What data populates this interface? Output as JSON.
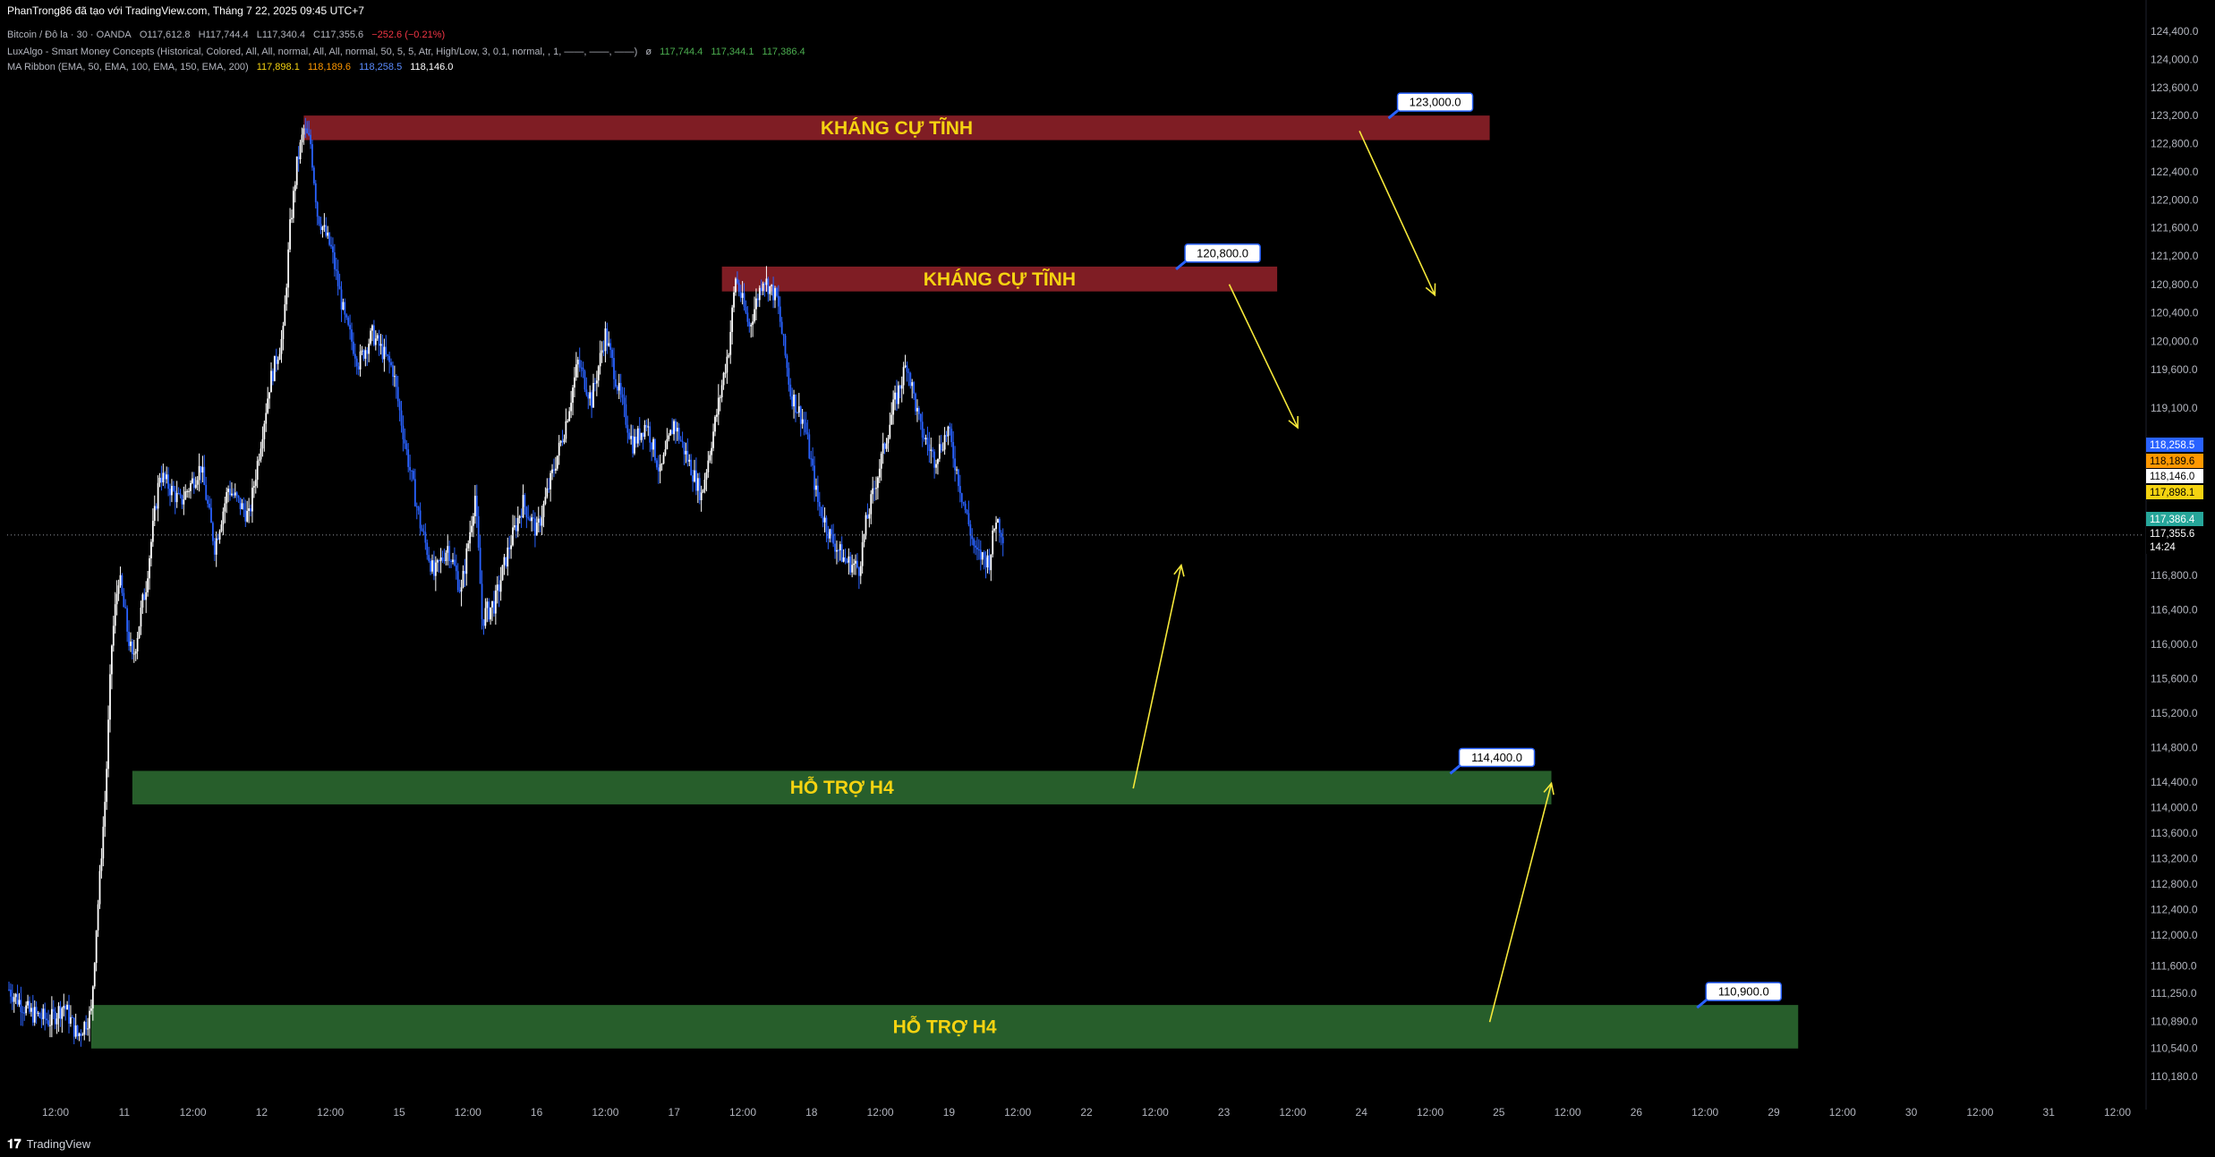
{
  "header": {
    "publisher_line": "PhanTrong86 đã tạo với TradingView.com, Tháng 7 22, 2025 09:45 UTC+7",
    "symbol": "Bitcoin / Đô la · 30 · OANDA",
    "ohlc": {
      "open": "O117,612.8",
      "high": "H117,744.4",
      "low": "L117,340.4",
      "close": "C117,355.6",
      "change": "−252.6 (−0.21%)"
    },
    "indicator1": {
      "name": "LuxAlgo - Smart Money Concepts (Historical, Colored, All, All, normal, All, All, normal, 50, 5, 5, Atr, High/Low, 3, 0.1, normal, , 1, ——, ——, ——)",
      "values": [
        "117,744.4",
        "117,344.1",
        "117,386.4"
      ]
    },
    "indicator2": {
      "name": "MA Ribbon (EMA, 50, EMA, 100, EMA, 150, EMA, 200)",
      "values": [
        "117,898.1",
        "118,189.6",
        "118,258.5",
        "118,146.0"
      ]
    }
  },
  "colors": {
    "background": "#000000",
    "bull_candle": "#ffffff",
    "bear_candle": "#2962ff",
    "resistance_zone": "#7f1d24",
    "support_zone": "#275e2b",
    "zone_text": "#f5d311",
    "arrow": "#f5e83a",
    "ema50": "#f5d311",
    "ema100": "#ff9800",
    "ema150": "#2962ff",
    "ema200": "#ffffff",
    "last_price": "#26a69a"
  },
  "chart_data": {
    "type": "candlestick",
    "ylim": [
      109900,
      124600
    ],
    "price_ticks": [
      "124,400.0",
      "124,000.0",
      "123,600.0",
      "123,200.0",
      "122,800.0",
      "122,400.0",
      "122,000.0",
      "121,600.0",
      "121,200.0",
      "120,800.0",
      "120,400.0",
      "120,000.0",
      "119,600.0",
      "119,100.0",
      "116,800.0",
      "116,400.0",
      "116,000.0",
      "115,600.0",
      "115,200.0",
      "114,800.0",
      "114,400.0",
      "114,000.0",
      "113,600.0",
      "113,200.0",
      "112,800.0",
      "112,400.0",
      "112,000.0",
      "111,600.0",
      "111,250.0",
      "110,890.0",
      "110,540.0",
      "110,180.0"
    ],
    "time_ticks": [
      "12:00",
      "11",
      "12:00",
      "12",
      "12:00",
      "15",
      "12:00",
      "16",
      "12:00",
      "17",
      "12:00",
      "18",
      "12:00",
      "19",
      "12:00",
      "22",
      "12:00",
      "23",
      "12:00",
      "24",
      "12:00",
      "25",
      "12:00",
      "26",
      "12:00",
      "29",
      "12:00",
      "30",
      "12:00",
      "31",
      "12:00"
    ],
    "price_path": [
      [
        0,
        111.3
      ],
      [
        3,
        111.0
      ],
      [
        6,
        110.9
      ],
      [
        8,
        111.1
      ],
      [
        10,
        110.7
      ],
      [
        12,
        111.0
      ],
      [
        13,
        112.5
      ],
      [
        14,
        114.1
      ],
      [
        15,
        116.0
      ],
      [
        16,
        116.8
      ],
      [
        18,
        115.8
      ],
      [
        20,
        116.7
      ],
      [
        22,
        118.2
      ],
      [
        25,
        117.8
      ],
      [
        28,
        118.3
      ],
      [
        30,
        117.2
      ],
      [
        32,
        118.0
      ],
      [
        35,
        117.6
      ],
      [
        38,
        119.4
      ],
      [
        40,
        120.1
      ],
      [
        41,
        121.6
      ],
      [
        42,
        122.5
      ],
      [
        43,
        123.0
      ],
      [
        44,
        122.8
      ],
      [
        45,
        121.8
      ],
      [
        47,
        121.3
      ],
      [
        49,
        120.3
      ],
      [
        51,
        119.7
      ],
      [
        53,
        120.1
      ],
      [
        56,
        119.6
      ],
      [
        58,
        118.5
      ],
      [
        60,
        117.5
      ],
      [
        62,
        116.8
      ],
      [
        64,
        117.2
      ],
      [
        66,
        116.6
      ],
      [
        68,
        117.9
      ],
      [
        69,
        116.3
      ],
      [
        71,
        116.5
      ],
      [
        73,
        117.2
      ],
      [
        75,
        117.8
      ],
      [
        77,
        117.4
      ],
      [
        79,
        118.1
      ],
      [
        81,
        118.8
      ],
      [
        83,
        119.7
      ],
      [
        85,
        119.2
      ],
      [
        87,
        120.1
      ],
      [
        89,
        119.3
      ],
      [
        91,
        118.6
      ],
      [
        93,
        118.9
      ],
      [
        95,
        118.2
      ],
      [
        97,
        118.9
      ],
      [
        99,
        118.4
      ],
      [
        101,
        117.9
      ],
      [
        103,
        118.9
      ],
      [
        105,
        119.9
      ],
      [
        106,
        120.9
      ],
      [
        108,
        120.2
      ],
      [
        110,
        120.9
      ],
      [
        112,
        120.6
      ],
      [
        114,
        119.3
      ],
      [
        116,
        118.9
      ],
      [
        118,
        117.8
      ],
      [
        120,
        117.3
      ],
      [
        122,
        117.0
      ],
      [
        124,
        116.9
      ],
      [
        125,
        117.5
      ],
      [
        127,
        118.3
      ],
      [
        129,
        119.1
      ],
      [
        131,
        119.7
      ],
      [
        133,
        118.8
      ],
      [
        135,
        118.4
      ],
      [
        137,
        118.8
      ],
      [
        139,
        117.9
      ],
      [
        141,
        117.1
      ],
      [
        143,
        117.0
      ],
      [
        144,
        117.6
      ],
      [
        145,
        117.36
      ]
    ],
    "zones": [
      {
        "label": "KHÁNG CỰ TĨNH",
        "kind": "resistance",
        "top": 123200,
        "bottom": 122850,
        "x_start": 43,
        "x_end": 216,
        "tag": "123,000.0"
      },
      {
        "label": "KHÁNG CỰ TĨNH",
        "kind": "resistance",
        "top": 121050,
        "bottom": 120700,
        "x_start": 104,
        "x_end": 185,
        "tag": "120,800.0"
      },
      {
        "label": "HỖ TRỢ H4",
        "kind": "support",
        "top": 114530,
        "bottom": 114050,
        "x_start": 18,
        "x_end": 225,
        "tag": "114,400.0"
      },
      {
        "label": "HỖ TRỢ H4",
        "kind": "support",
        "top": 111100,
        "bottom": 110540,
        "x_start": 12,
        "x_end": 261,
        "tag": "110,900.0"
      }
    ],
    "arrows": [
      {
        "from": [
          197,
          122980
        ],
        "to": [
          208,
          120650
        ]
      },
      {
        "from": [
          178,
          120800
        ],
        "to": [
          188,
          118830
        ]
      },
      {
        "from": [
          164,
          114300
        ],
        "to": [
          171,
          116940
        ]
      },
      {
        "from": [
          216,
          110880
        ],
        "to": [
          225,
          114380
        ]
      }
    ],
    "price_labels": [
      {
        "text": "118,258.5",
        "price": 118258.5,
        "color_key": "ema150"
      },
      {
        "text": "118,189.6",
        "price": 118189.6,
        "color_key": "ema100"
      },
      {
        "text": "118,146.0",
        "price": 118146.0,
        "color_key": "ema200"
      },
      {
        "text": "117,898.1",
        "price": 117898.1,
        "color_key": "ema50"
      },
      {
        "text": "117,386.4",
        "price": 117386.4,
        "color_key": "last_price"
      },
      {
        "text": "117,355.6",
        "price": 117355.6,
        "color_key": "background"
      },
      {
        "text": "14:24",
        "price": 117355.6,
        "color_key": "background"
      }
    ],
    "last_price": 117355.6
  },
  "footer": {
    "brand": "TradingView"
  }
}
